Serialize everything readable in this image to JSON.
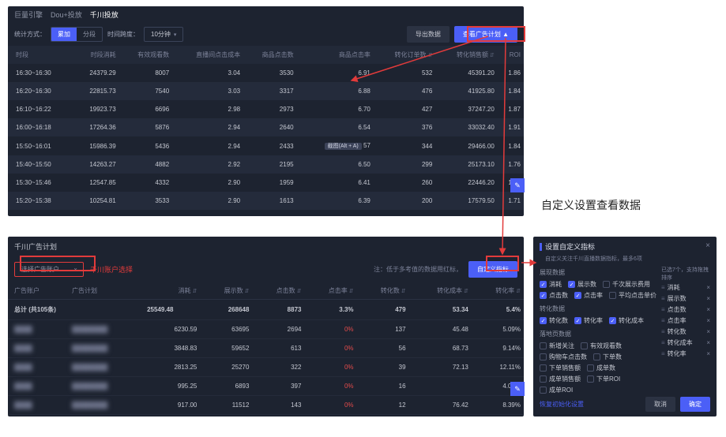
{
  "top": {
    "tabs": [
      "巨量引擎",
      "Dou+投放",
      "千川投放"
    ],
    "ctrl": {
      "mode_label": "统计方式：",
      "mode_opts": [
        "累加",
        "分段"
      ],
      "gran_label": "时间跨度：",
      "gran_value": "10分钟"
    },
    "btn_export": "导出数据",
    "btn_view": "查看广告计划 ▲",
    "cols": [
      "时段",
      "时段消耗",
      "有效观看数",
      "直播间点击成本",
      "商品点击数",
      "商品点击率",
      "转化订单数",
      "转化销售额",
      "ROI"
    ],
    "rows": [
      [
        "16:30~16:30",
        "24379.29",
        "8007",
        "3.04",
        "3530",
        "6.91",
        "532",
        "45391.20",
        "1.86"
      ],
      [
        "16:20~16:30",
        "22815.73",
        "7540",
        "3.03",
        "3317",
        "6.88",
        "476",
        "41925.80",
        "1.84"
      ],
      [
        "16:10~16:22",
        "19923.73",
        "6696",
        "2.98",
        "2973",
        "6.70",
        "427",
        "37247.20",
        "1.87"
      ],
      [
        "16:00~16:18",
        "17264.36",
        "5876",
        "2.94",
        "2640",
        "6.54",
        "376",
        "33032.40",
        "1.91"
      ],
      [
        "15:50~16:01",
        "15986.39",
        "5436",
        "2.94",
        "2433",
        "",
        "344",
        "29466.00",
        "1.84"
      ],
      [
        "15:40~15:50",
        "14263.27",
        "4882",
        "2.92",
        "2195",
        "6.50",
        "299",
        "25173.10",
        "1.76"
      ],
      [
        "15:30~15:46",
        "12547.85",
        "4332",
        "2.90",
        "1959",
        "6.41",
        "260",
        "22446.20",
        "1.79"
      ],
      [
        "15:20~15:38",
        "10254.81",
        "3533",
        "2.90",
        "1613",
        "6.39",
        "200",
        "17579.50",
        "1.71"
      ]
    ],
    "row4_tag": "截图(Alt + A)",
    "row4_after": "57"
  },
  "bl": {
    "title": "千川广告计划",
    "acc_placeholder": "选择广告账户",
    "acc_label": "千川账户选择",
    "note": "注：低于多考值的数据用红标，",
    "btn_custom": "自定义指标",
    "cols": [
      "广告账户",
      "广告计划",
      "消耗",
      "展示数",
      "点击数",
      "点击率",
      "转化数",
      "转化成本",
      "转化率"
    ],
    "total_label": "总计 (共105条)",
    "total": [
      "25549.48",
      "268648",
      "8873",
      "3.3%",
      "479",
      "53.34",
      "5.4%"
    ],
    "rows": [
      [
        "6230.59",
        "63695",
        "2694",
        "0%",
        "137",
        "45.48",
        "5.09%"
      ],
      [
        "3848.83",
        "59652",
        "613",
        "0%",
        "56",
        "68.73",
        "9.14%"
      ],
      [
        "2813.25",
        "25270",
        "322",
        "0%",
        "39",
        "72.13",
        "12.11%"
      ],
      [
        "995.25",
        "6893",
        "397",
        "0%",
        "16",
        "",
        "4.03%"
      ],
      [
        "917.00",
        "11512",
        "143",
        "0%",
        "12",
        "76.42",
        "8.39%"
      ]
    ]
  },
  "br": {
    "title": "设置自定义指标",
    "sub": "自定义关注千川直播数据指标，最多6项",
    "groups": [
      {
        "name": "展现数据",
        "items": [
          {
            "l": "消耗",
            "on": true
          },
          {
            "l": "展示数",
            "on": true
          },
          {
            "l": "千次展示费用",
            "on": false
          },
          {
            "l": "点击数",
            "on": true
          },
          {
            "l": "点击率",
            "on": true
          },
          {
            "l": "平均点击单价",
            "on": false
          }
        ]
      },
      {
        "name": "转化数据",
        "items": [
          {
            "l": "转化数",
            "on": true
          },
          {
            "l": "转化率",
            "on": true
          },
          {
            "l": "转化成本",
            "on": true
          }
        ]
      },
      {
        "name": "落地页数据",
        "items": [
          {
            "l": "新增关注",
            "on": false
          },
          {
            "l": "有效观看数",
            "on": false
          },
          {
            "l": "购物车点击数",
            "on": false
          },
          {
            "l": "下单数",
            "on": false
          },
          {
            "l": "下单销售额",
            "on": false
          },
          {
            "l": "成单数",
            "on": false
          },
          {
            "l": "成单销售额",
            "on": false
          },
          {
            "l": "下单ROI",
            "on": false
          },
          {
            "l": "成单ROI",
            "on": false
          }
        ]
      }
    ],
    "selected_label": "已选7个，支持拖拽排序",
    "selected": [
      "消耗",
      "展示数",
      "点击数",
      "点击率",
      "转化数",
      "转化成本",
      "转化率"
    ],
    "restore": "恢复初始化设置",
    "cancel": "取消",
    "ok": "确定"
  },
  "anno": "自定义设置查看数据"
}
